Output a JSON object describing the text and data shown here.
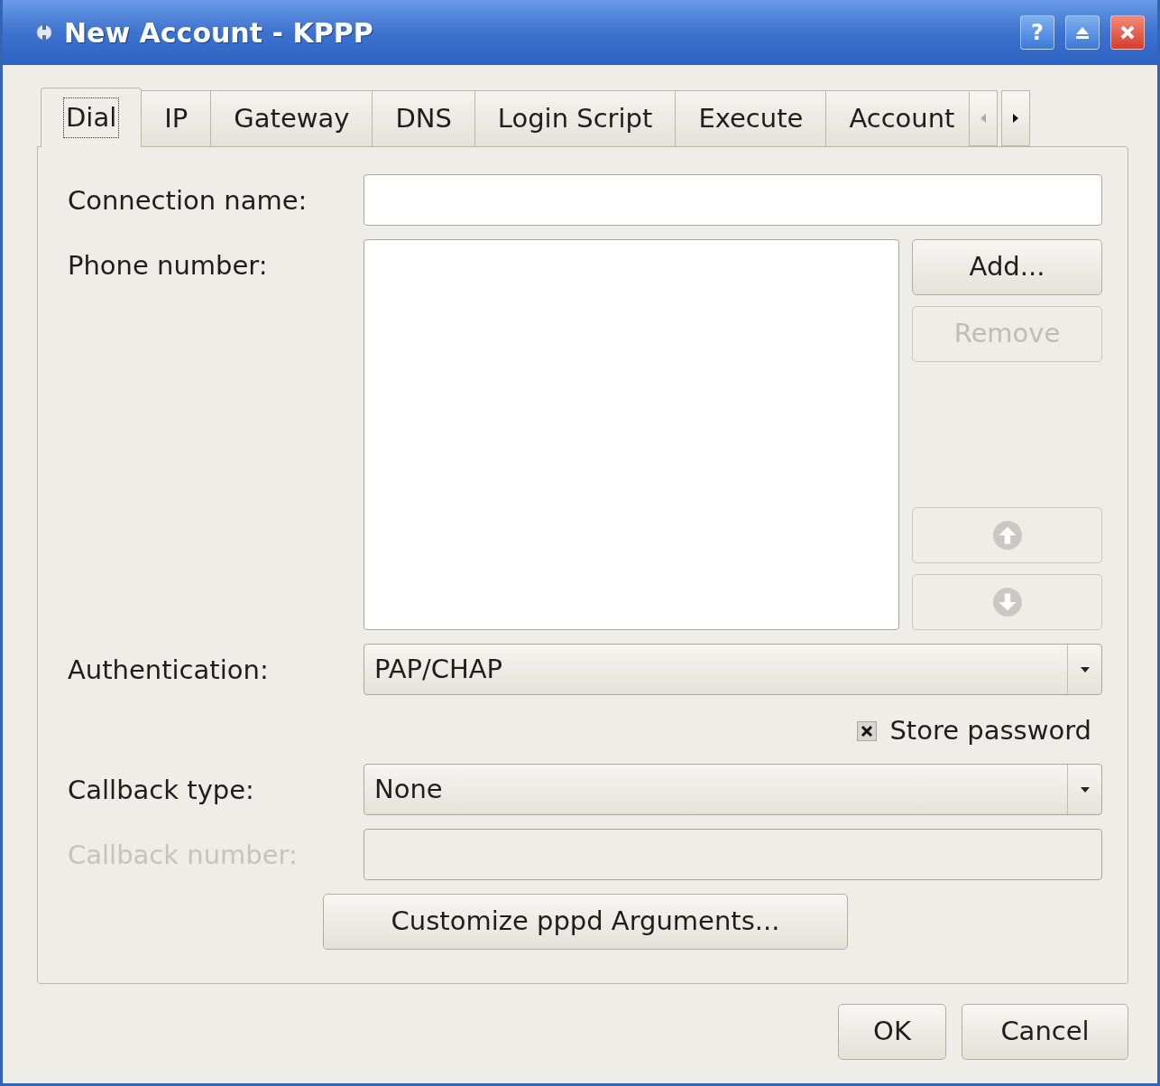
{
  "window": {
    "title": "New Account - KPPP",
    "help": "?"
  },
  "tabs": [
    {
      "label": "Dial",
      "selected": true
    },
    {
      "label": "IP",
      "selected": false
    },
    {
      "label": "Gateway",
      "selected": false
    },
    {
      "label": "DNS",
      "selected": false
    },
    {
      "label": "Login Script",
      "selected": false
    },
    {
      "label": "Execute",
      "selected": false
    },
    {
      "label": "Account",
      "selected": false
    }
  ],
  "form": {
    "connection_name": {
      "label": "Connection name:"
    },
    "phone_number": {
      "label": "Phone number:",
      "buttons": [
        {
          "kind": "text",
          "label": "Add...",
          "disabled": false
        },
        {
          "kind": "text",
          "label": "Remove",
          "disabled": true
        },
        {
          "kind": "up",
          "disabled": true
        },
        {
          "kind": "down",
          "disabled": true
        }
      ]
    },
    "authentication": {
      "label": "Authentication:",
      "value": "PAP/CHAP"
    },
    "store_password": {
      "label": "Store password",
      "checked": true
    },
    "callback_type": {
      "label": "Callback type:",
      "value": "None"
    },
    "callback_number": {
      "label": "Callback number:",
      "disabled": true
    },
    "customize_button": {
      "label": "Customize pppd Arguments..."
    }
  },
  "buttons": [
    {
      "label": "OK"
    },
    {
      "label": "Cancel"
    }
  ]
}
